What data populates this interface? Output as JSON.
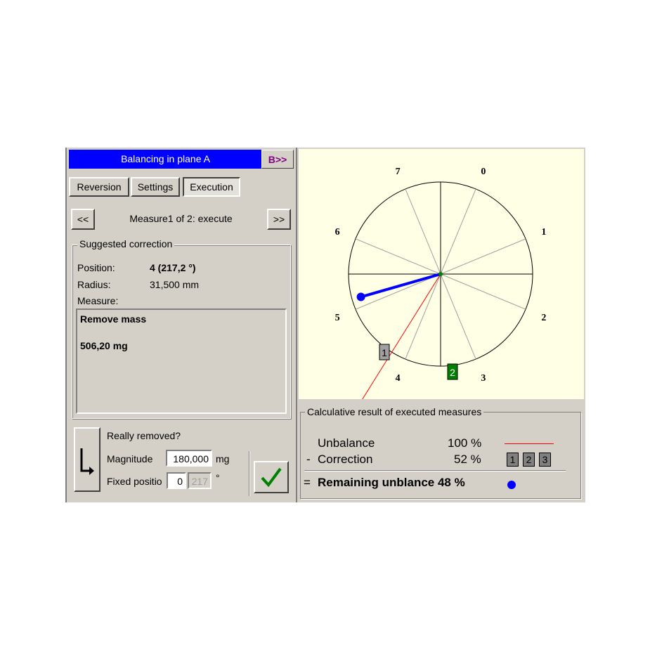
{
  "header": {
    "title": "Balancing in plane A",
    "plane_button": "B>>"
  },
  "tabs": [
    {
      "label": "Reversion"
    },
    {
      "label": "Settings"
    },
    {
      "label": "Execution"
    }
  ],
  "nav": {
    "prev": "<<",
    "next": ">>",
    "label": "Measure1 of 2: execute"
  },
  "suggested": {
    "title": "Suggested correction",
    "position_label": "Position:",
    "position_value": "4 (217,2 °)",
    "radius_label": "Radius:",
    "radius_value": "31,500 mm",
    "measure_label": "Measure:",
    "measure_line1": "Remove mass",
    "measure_line2": "506,20 mg"
  },
  "confirm": {
    "question": "Really removed?",
    "magnitude_label": "Magnitude",
    "magnitude_value": "180,000",
    "magnitude_unit": "mg",
    "fixed_label": "Fixed positio",
    "fixed_value": "0",
    "fixed_angle": "217",
    "fixed_unit": "°"
  },
  "plot": {
    "positions": [
      "0",
      "1",
      "2",
      "3",
      "4",
      "5",
      "6",
      "7"
    ],
    "markers": [
      "1",
      "2"
    ],
    "colors": {
      "unbalance": "#ff0000",
      "remaining": "#0000ff",
      "marker2": "#008000",
      "marker1": "#a0a0a0"
    }
  },
  "result": {
    "title": "Calculative result of executed measures",
    "unbalance_label": "Unbalance",
    "unbalance_value": "100 %",
    "correction_prefix": "-",
    "correction_label": "Correction",
    "correction_value": "52 %",
    "correction_boxes": [
      "1",
      "2",
      "3"
    ],
    "remaining_prefix": "=",
    "remaining_label": "Remaining unblance 48 %"
  }
}
